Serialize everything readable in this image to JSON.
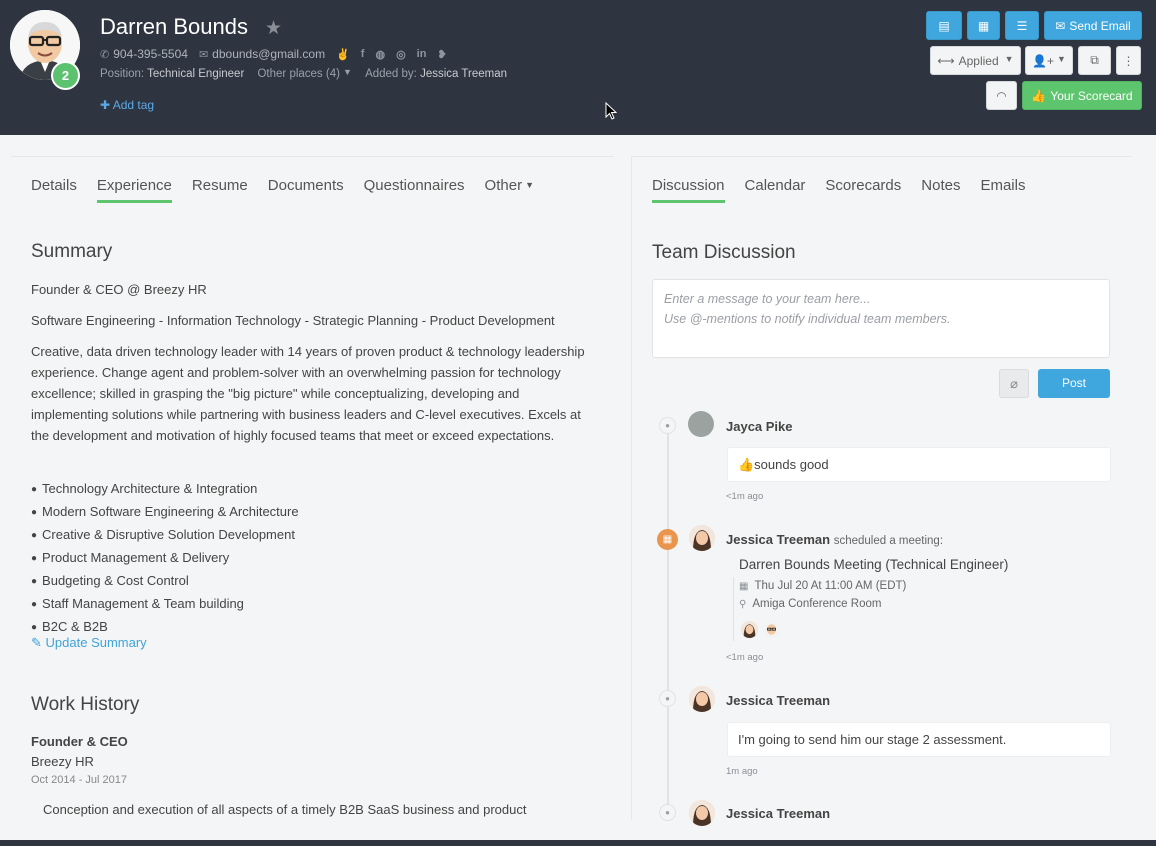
{
  "candidate": {
    "name": "Darren Bounds",
    "score": "2",
    "phone": "904-395-5504",
    "email": "dbounds@gmail.com",
    "position_label": "Position:",
    "position": "Technical Engineer",
    "other_places": "Other places (4)",
    "added_by_label": "Added by:",
    "added_by": "Jessica Treeman",
    "add_tag": "Add tag"
  },
  "header_actions": {
    "stage": "Applied",
    "send_email": "Send Email",
    "scorecard": "Your Scorecard"
  },
  "left_tabs": [
    "Details",
    "Experience",
    "Resume",
    "Documents",
    "Questionnaires",
    "Other"
  ],
  "right_tabs": [
    "Discussion",
    "Calendar",
    "Scorecards",
    "Notes",
    "Emails"
  ],
  "summary": {
    "title": "Summary",
    "line1": "Founder & CEO @ Breezy HR",
    "line2": "Software Engineering - Information Technology - Strategic Planning - Product Development",
    "paragraph": "Creative, data driven technology leader with 14 years of proven product & technology leadership experience. Change agent and problem-solver with an overwhelming passion for technology excellence; skilled in grasping the \"big picture\" while conceptualizing, developing and implementing solutions while partnering with business leaders and C-level executives. Excels at the development and motivation of highly focused teams that meet or exceed expectations.",
    "bullets": [
      "Technology Architecture & Integration",
      "Modern Software Engineering & Architecture",
      "Creative & Disruptive Solution Development",
      "Product Management & Delivery",
      "Budgeting & Cost Control",
      "Staff Management & Team building",
      "B2C & B2B"
    ],
    "update_link": "Update Summary"
  },
  "work_history": {
    "title": "Work History",
    "job_title": "Founder & CEO",
    "company": "Breezy HR",
    "dates": "Oct 2014 - Jul 2017",
    "description": "Conception and execution of all aspects of a timely B2B SaaS business and product"
  },
  "discussion": {
    "title": "Team Discussion",
    "placeholder_line1": "Enter a message to your team here...",
    "placeholder_line2": "Use @-mentions to notify individual team members.",
    "post_label": "Post",
    "entries": [
      {
        "author": "Jayca Pike",
        "action": "",
        "message": "👍sounds good",
        "time": "<1m ago"
      },
      {
        "author": "Jessica Treeman",
        "action": "scheduled a meeting:",
        "meeting_title": "Darren Bounds Meeting (Technical Engineer)",
        "meeting_time": "Thu Jul 20 At 11:00 AM (EDT)",
        "meeting_place": "Amiga Conference Room",
        "time": "<1m ago"
      },
      {
        "author": "Jessica Treeman",
        "action": "",
        "message": "I'm going to send him our stage 2 assessment.",
        "time": "1m ago"
      },
      {
        "author": "Jessica Treeman",
        "action": ""
      }
    ]
  },
  "colors": {
    "header_bg": "#2f3540",
    "accent_blue": "#3fa7de",
    "accent_green": "#5dc56e",
    "meeting_orange": "#e9954d"
  }
}
